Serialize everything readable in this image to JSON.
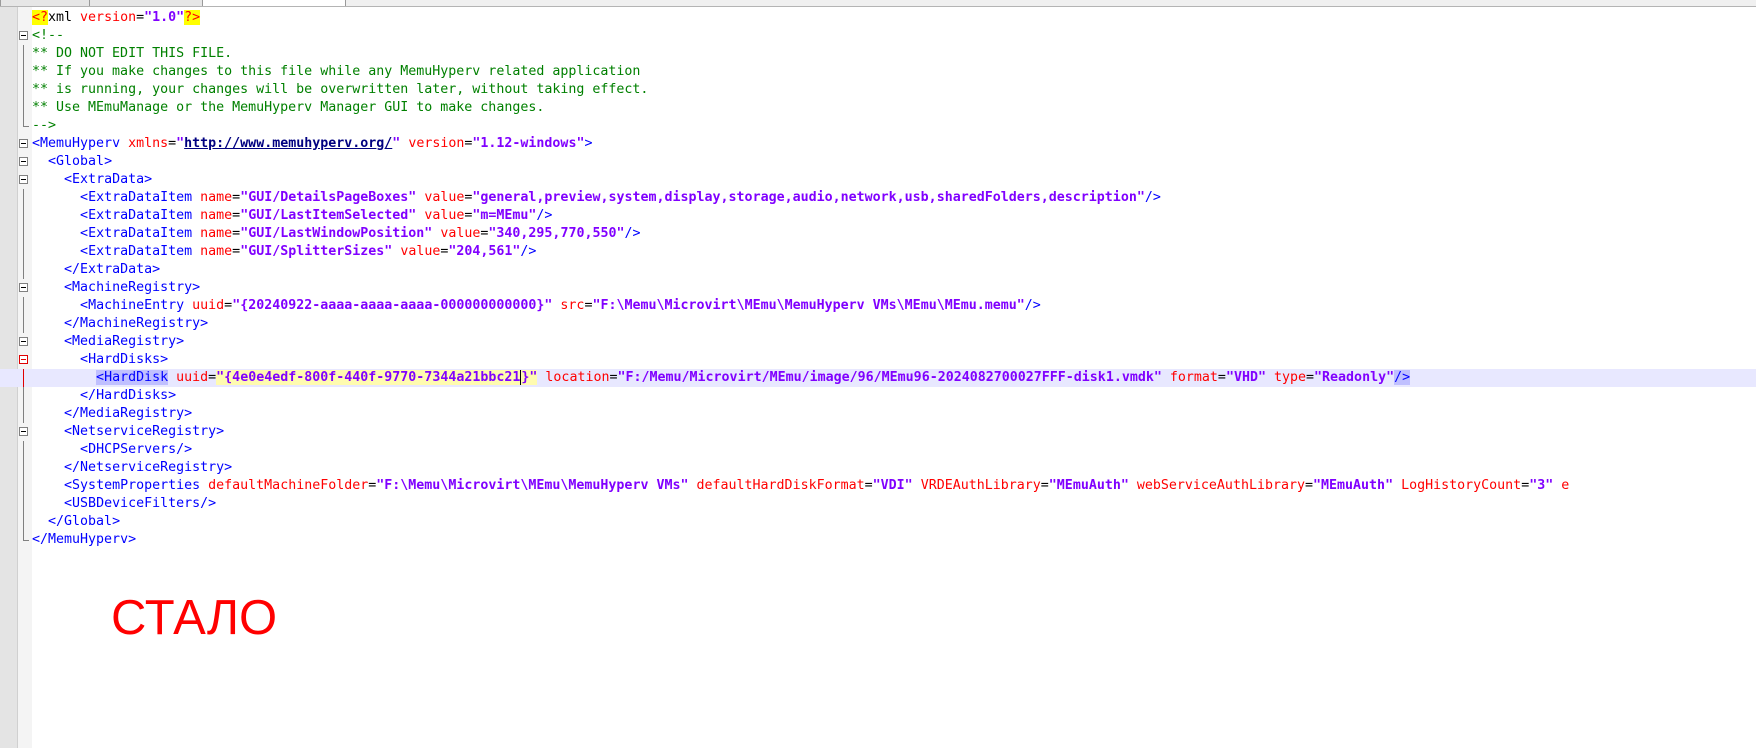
{
  "annotation": "СТАЛО",
  "lines": [
    {
      "fold": "none",
      "tokens": [
        {
          "c": "t-decl hl-yellow",
          "t": "<?"
        },
        {
          "c": "t-text",
          "t": "xml "
        },
        {
          "c": "t-attr",
          "t": "version"
        },
        {
          "c": "t-eq",
          "t": "="
        },
        {
          "c": "t-val",
          "t": "\"1.0\""
        },
        {
          "c": "t-decl hl-yellow",
          "t": "?>"
        }
      ]
    },
    {
      "fold": "open",
      "tokens": [
        {
          "c": "t-comment",
          "t": "<!--"
        }
      ]
    },
    {
      "fold": "line",
      "tokens": [
        {
          "c": "t-comment",
          "t": "** DO NOT EDIT THIS FILE."
        }
      ]
    },
    {
      "fold": "line",
      "tokens": [
        {
          "c": "t-comment",
          "t": "** If you make changes to this file while any MemuHyperv related application"
        }
      ]
    },
    {
      "fold": "line",
      "tokens": [
        {
          "c": "t-comment",
          "t": "** is running, your changes will be overwritten later, without taking effect."
        }
      ]
    },
    {
      "fold": "line",
      "tokens": [
        {
          "c": "t-comment",
          "t": "** Use MEmuManage or the MemuHyperv Manager GUI to make changes."
        }
      ]
    },
    {
      "fold": "end",
      "tokens": [
        {
          "c": "t-comment",
          "t": "-->"
        }
      ]
    },
    {
      "fold": "open",
      "tokens": [
        {
          "c": "t-bracket",
          "t": "<"
        },
        {
          "c": "t-tag",
          "t": "MemuHyperv "
        },
        {
          "c": "t-attr",
          "t": "xmlns"
        },
        {
          "c": "t-eq",
          "t": "="
        },
        {
          "c": "t-val",
          "t": "\""
        },
        {
          "c": "t-url",
          "t": "http://www.memuhyperv.org/"
        },
        {
          "c": "t-val",
          "t": "\""
        },
        {
          "c": "t-text",
          "t": " "
        },
        {
          "c": "t-attr",
          "t": "version"
        },
        {
          "c": "t-eq",
          "t": "="
        },
        {
          "c": "t-val",
          "t": "\"1.12-windows\""
        },
        {
          "c": "t-bracket",
          "t": ">"
        }
      ]
    },
    {
      "fold": "open",
      "tokens": [
        {
          "c": "t-text",
          "t": "  "
        },
        {
          "c": "t-bracket",
          "t": "<"
        },
        {
          "c": "t-tag",
          "t": "Global"
        },
        {
          "c": "t-bracket",
          "t": ">"
        }
      ]
    },
    {
      "fold": "open",
      "tokens": [
        {
          "c": "t-text",
          "t": "    "
        },
        {
          "c": "t-bracket",
          "t": "<"
        },
        {
          "c": "t-tag",
          "t": "ExtraData"
        },
        {
          "c": "t-bracket",
          "t": ">"
        }
      ]
    },
    {
      "fold": "line",
      "tokens": [
        {
          "c": "t-text",
          "t": "      "
        },
        {
          "c": "t-bracket",
          "t": "<"
        },
        {
          "c": "t-tag",
          "t": "ExtraDataItem "
        },
        {
          "c": "t-attr",
          "t": "name"
        },
        {
          "c": "t-eq",
          "t": "="
        },
        {
          "c": "t-val",
          "t": "\"GUI/DetailsPageBoxes\""
        },
        {
          "c": "t-text",
          "t": " "
        },
        {
          "c": "t-attr",
          "t": "value"
        },
        {
          "c": "t-eq",
          "t": "="
        },
        {
          "c": "t-val",
          "t": "\"general,preview,system,display,storage,audio,network,usb,sharedFolders,description\""
        },
        {
          "c": "t-bracket",
          "t": "/>"
        }
      ]
    },
    {
      "fold": "line",
      "tokens": [
        {
          "c": "t-text",
          "t": "      "
        },
        {
          "c": "t-bracket",
          "t": "<"
        },
        {
          "c": "t-tag",
          "t": "ExtraDataItem "
        },
        {
          "c": "t-attr",
          "t": "name"
        },
        {
          "c": "t-eq",
          "t": "="
        },
        {
          "c": "t-val",
          "t": "\"GUI/LastItemSelected\""
        },
        {
          "c": "t-text",
          "t": " "
        },
        {
          "c": "t-attr",
          "t": "value"
        },
        {
          "c": "t-eq",
          "t": "="
        },
        {
          "c": "t-val",
          "t": "\"m=MEmu\""
        },
        {
          "c": "t-bracket",
          "t": "/>"
        }
      ]
    },
    {
      "fold": "line",
      "tokens": [
        {
          "c": "t-text",
          "t": "      "
        },
        {
          "c": "t-bracket",
          "t": "<"
        },
        {
          "c": "t-tag",
          "t": "ExtraDataItem "
        },
        {
          "c": "t-attr",
          "t": "name"
        },
        {
          "c": "t-eq",
          "t": "="
        },
        {
          "c": "t-val",
          "t": "\"GUI/LastWindowPosition\""
        },
        {
          "c": "t-text",
          "t": " "
        },
        {
          "c": "t-attr",
          "t": "value"
        },
        {
          "c": "t-eq",
          "t": "="
        },
        {
          "c": "t-val",
          "t": "\"340,295,770,550\""
        },
        {
          "c": "t-bracket",
          "t": "/>"
        }
      ]
    },
    {
      "fold": "line",
      "tokens": [
        {
          "c": "t-text",
          "t": "      "
        },
        {
          "c": "t-bracket",
          "t": "<"
        },
        {
          "c": "t-tag",
          "t": "ExtraDataItem "
        },
        {
          "c": "t-attr",
          "t": "name"
        },
        {
          "c": "t-eq",
          "t": "="
        },
        {
          "c": "t-val",
          "t": "\"GUI/SplitterSizes\""
        },
        {
          "c": "t-text",
          "t": " "
        },
        {
          "c": "t-attr",
          "t": "value"
        },
        {
          "c": "t-eq",
          "t": "="
        },
        {
          "c": "t-val",
          "t": "\"204,561\""
        },
        {
          "c": "t-bracket",
          "t": "/>"
        }
      ]
    },
    {
      "fold": "line",
      "tokens": [
        {
          "c": "t-text",
          "t": "    "
        },
        {
          "c": "t-bracket",
          "t": "</"
        },
        {
          "c": "t-tag",
          "t": "ExtraData"
        },
        {
          "c": "t-bracket",
          "t": ">"
        }
      ]
    },
    {
      "fold": "open",
      "tokens": [
        {
          "c": "t-text",
          "t": "    "
        },
        {
          "c": "t-bracket",
          "t": "<"
        },
        {
          "c": "t-tag",
          "t": "MachineRegistry"
        },
        {
          "c": "t-bracket",
          "t": ">"
        }
      ]
    },
    {
      "fold": "line",
      "tokens": [
        {
          "c": "t-text",
          "t": "      "
        },
        {
          "c": "t-bracket",
          "t": "<"
        },
        {
          "c": "t-tag",
          "t": "MachineEntry "
        },
        {
          "c": "t-attr",
          "t": "uuid"
        },
        {
          "c": "t-eq",
          "t": "="
        },
        {
          "c": "t-val",
          "t": "\"{20240922-aaaa-aaaa-aaaa-000000000000}\""
        },
        {
          "c": "t-text",
          "t": " "
        },
        {
          "c": "t-attr",
          "t": "src"
        },
        {
          "c": "t-eq",
          "t": "="
        },
        {
          "c": "t-val",
          "t": "\"F:\\Memu\\Microvirt\\MEmu\\MemuHyperv VMs\\MEmu\\MEmu.memu\""
        },
        {
          "c": "t-bracket",
          "t": "/>"
        }
      ]
    },
    {
      "fold": "line",
      "tokens": [
        {
          "c": "t-text",
          "t": "    "
        },
        {
          "c": "t-bracket",
          "t": "</"
        },
        {
          "c": "t-tag",
          "t": "MachineRegistry"
        },
        {
          "c": "t-bracket",
          "t": ">"
        }
      ]
    },
    {
      "fold": "open",
      "tokens": [
        {
          "c": "t-text",
          "t": "    "
        },
        {
          "c": "t-bracket",
          "t": "<"
        },
        {
          "c": "t-tag",
          "t": "MediaRegistry"
        },
        {
          "c": "t-bracket",
          "t": ">"
        }
      ]
    },
    {
      "fold": "open-red",
      "tokens": [
        {
          "c": "t-text",
          "t": "      "
        },
        {
          "c": "t-bracket",
          "t": "<"
        },
        {
          "c": "t-tag",
          "t": "HardDisks"
        },
        {
          "c": "t-bracket",
          "t": ">"
        }
      ]
    },
    {
      "fold": "line-red",
      "current": true,
      "tokens": [
        {
          "c": "t-text",
          "t": "        "
        },
        {
          "c": "t-bracket hl-match",
          "t": "<"
        },
        {
          "c": "t-tag hl-match",
          "t": "HardDisk"
        },
        {
          "c": "t-text",
          "t": " "
        },
        {
          "c": "t-attr",
          "t": "uuid"
        },
        {
          "c": "t-eq",
          "t": "="
        },
        {
          "c": "t-val hl-caretline",
          "t": "\"{4e0e4edf-800f-440f-9770-7344a21bbc21"
        },
        {
          "c": "t-val hl-caretline caret",
          "t": ""
        },
        {
          "c": "t-val hl-caretline",
          "t": "}\""
        },
        {
          "c": "t-text",
          "t": " "
        },
        {
          "c": "t-attr",
          "t": "location"
        },
        {
          "c": "t-eq",
          "t": "="
        },
        {
          "c": "t-val",
          "t": "\"F:/Memu/Microvirt/MEmu/image/96/MEmu96-2024082700027FFF-disk1.vmdk\""
        },
        {
          "c": "t-text",
          "t": " "
        },
        {
          "c": "t-attr",
          "t": "format"
        },
        {
          "c": "t-eq",
          "t": "="
        },
        {
          "c": "t-val",
          "t": "\"VHD\""
        },
        {
          "c": "t-text",
          "t": " "
        },
        {
          "c": "t-attr",
          "t": "type"
        },
        {
          "c": "t-eq",
          "t": "="
        },
        {
          "c": "t-val",
          "t": "\"Readonly\""
        },
        {
          "c": "t-bracket hl-match",
          "t": "/>"
        }
      ]
    },
    {
      "fold": "line",
      "tokens": [
        {
          "c": "t-text",
          "t": "      "
        },
        {
          "c": "t-bracket",
          "t": "</"
        },
        {
          "c": "t-tag",
          "t": "HardDisks"
        },
        {
          "c": "t-bracket",
          "t": ">"
        }
      ]
    },
    {
      "fold": "line",
      "tokens": [
        {
          "c": "t-text",
          "t": "    "
        },
        {
          "c": "t-bracket",
          "t": "</"
        },
        {
          "c": "t-tag",
          "t": "MediaRegistry"
        },
        {
          "c": "t-bracket",
          "t": ">"
        }
      ]
    },
    {
      "fold": "open",
      "tokens": [
        {
          "c": "t-text",
          "t": "    "
        },
        {
          "c": "t-bracket",
          "t": "<"
        },
        {
          "c": "t-tag",
          "t": "NetserviceRegistry"
        },
        {
          "c": "t-bracket",
          "t": ">"
        }
      ]
    },
    {
      "fold": "line",
      "tokens": [
        {
          "c": "t-text",
          "t": "      "
        },
        {
          "c": "t-bracket",
          "t": "<"
        },
        {
          "c": "t-tag",
          "t": "DHCPServers"
        },
        {
          "c": "t-bracket",
          "t": "/>"
        }
      ]
    },
    {
      "fold": "line",
      "tokens": [
        {
          "c": "t-text",
          "t": "    "
        },
        {
          "c": "t-bracket",
          "t": "</"
        },
        {
          "c": "t-tag",
          "t": "NetserviceRegistry"
        },
        {
          "c": "t-bracket",
          "t": ">"
        }
      ]
    },
    {
      "fold": "line",
      "tokens": [
        {
          "c": "t-text",
          "t": "    "
        },
        {
          "c": "t-bracket",
          "t": "<"
        },
        {
          "c": "t-tag",
          "t": "SystemProperties "
        },
        {
          "c": "t-attr",
          "t": "defaultMachineFolder"
        },
        {
          "c": "t-eq",
          "t": "="
        },
        {
          "c": "t-val",
          "t": "\"F:\\Memu\\Microvirt\\MEmu\\MemuHyperv VMs\""
        },
        {
          "c": "t-text",
          "t": " "
        },
        {
          "c": "t-attr",
          "t": "defaultHardDiskFormat"
        },
        {
          "c": "t-eq",
          "t": "="
        },
        {
          "c": "t-val",
          "t": "\"VDI\""
        },
        {
          "c": "t-text",
          "t": " "
        },
        {
          "c": "t-attr",
          "t": "VRDEAuthLibrary"
        },
        {
          "c": "t-eq",
          "t": "="
        },
        {
          "c": "t-val",
          "t": "\"MEmuAuth\""
        },
        {
          "c": "t-text",
          "t": " "
        },
        {
          "c": "t-attr",
          "t": "webServiceAuthLibrary"
        },
        {
          "c": "t-eq",
          "t": "="
        },
        {
          "c": "t-val",
          "t": "\"MEmuAuth\""
        },
        {
          "c": "t-text",
          "t": " "
        },
        {
          "c": "t-attr",
          "t": "LogHistoryCount"
        },
        {
          "c": "t-eq",
          "t": "="
        },
        {
          "c": "t-val",
          "t": "\"3\""
        },
        {
          "c": "t-text",
          "t": " "
        },
        {
          "c": "t-attr",
          "t": "e"
        }
      ]
    },
    {
      "fold": "line",
      "tokens": [
        {
          "c": "t-text",
          "t": "    "
        },
        {
          "c": "t-bracket",
          "t": "<"
        },
        {
          "c": "t-tag",
          "t": "USBDeviceFilters"
        },
        {
          "c": "t-bracket",
          "t": "/>"
        }
      ]
    },
    {
      "fold": "line",
      "tokens": [
        {
          "c": "t-text",
          "t": "  "
        },
        {
          "c": "t-bracket",
          "t": "</"
        },
        {
          "c": "t-tag",
          "t": "Global"
        },
        {
          "c": "t-bracket",
          "t": ">"
        }
      ]
    },
    {
      "fold": "end",
      "tokens": [
        {
          "c": "t-bracket",
          "t": "</"
        },
        {
          "c": "t-tag",
          "t": "MemuHyperv"
        },
        {
          "c": "t-bracket",
          "t": ">"
        }
      ]
    }
  ]
}
